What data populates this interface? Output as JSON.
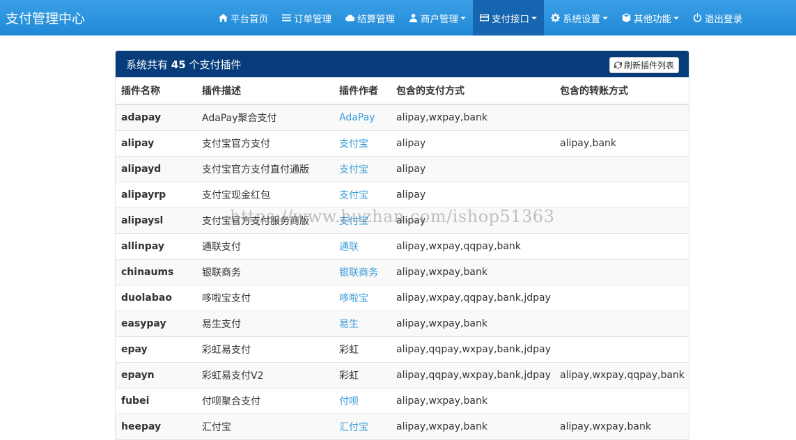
{
  "brand": "支付管理中心",
  "nav": [
    {
      "label": "平台首页",
      "icon": "home-icon",
      "caret": false,
      "active": false
    },
    {
      "label": "订单管理",
      "icon": "list-icon",
      "caret": false,
      "active": false
    },
    {
      "label": "结算管理",
      "icon": "cloud-icon",
      "caret": false,
      "active": false
    },
    {
      "label": "商户管理",
      "icon": "user-icon",
      "caret": true,
      "active": false
    },
    {
      "label": "支付接口",
      "icon": "credit-card-icon",
      "caret": true,
      "active": true
    },
    {
      "label": "系统设置",
      "icon": "gear-icon",
      "caret": true,
      "active": false
    },
    {
      "label": "其他功能",
      "icon": "cube-icon",
      "caret": true,
      "active": false
    },
    {
      "label": "退出登录",
      "icon": "power-icon",
      "caret": false,
      "active": false
    }
  ],
  "panel": {
    "title_prefix": "系统共有",
    "count": "45",
    "title_suffix": "个支付插件",
    "refresh_label": "刷新插件列表"
  },
  "table": {
    "headers": [
      "插件名称",
      "插件描述",
      "插件作者",
      "包含的支付方式",
      "包含的转账方式"
    ],
    "rows": [
      {
        "name": "adapay",
        "desc": "AdaPay聚合支付",
        "author": "AdaPay",
        "author_link": true,
        "pay": "alipay,wxpay,bank",
        "transfer": ""
      },
      {
        "name": "alipay",
        "desc": "支付宝官方支付",
        "author": "支付宝",
        "author_link": true,
        "pay": "alipay",
        "transfer": "alipay,bank"
      },
      {
        "name": "alipayd",
        "desc": "支付宝官方支付直付通版",
        "author": "支付宝",
        "author_link": true,
        "pay": "alipay",
        "transfer": ""
      },
      {
        "name": "alipayrp",
        "desc": "支付宝现金红包",
        "author": "支付宝",
        "author_link": true,
        "pay": "alipay",
        "transfer": ""
      },
      {
        "name": "alipaysl",
        "desc": "支付宝官方支付服务商版",
        "author": "支付宝",
        "author_link": true,
        "pay": "alipay",
        "transfer": ""
      },
      {
        "name": "allinpay",
        "desc": "通联支付",
        "author": "通联",
        "author_link": true,
        "pay": "alipay,wxpay,qqpay,bank",
        "transfer": ""
      },
      {
        "name": "chinaums",
        "desc": "银联商务",
        "author": "银联商务",
        "author_link": true,
        "pay": "alipay,wxpay,bank",
        "transfer": ""
      },
      {
        "name": "duolabao",
        "desc": "哆啦宝支付",
        "author": "哆啦宝",
        "author_link": true,
        "pay": "alipay,wxpay,qqpay,bank,jdpay",
        "transfer": ""
      },
      {
        "name": "easypay",
        "desc": "易生支付",
        "author": "易生",
        "author_link": true,
        "pay": "alipay,wxpay,bank",
        "transfer": ""
      },
      {
        "name": "epay",
        "desc": "彩虹易支付",
        "author": "彩虹",
        "author_link": false,
        "pay": "alipay,qqpay,wxpay,bank,jdpay",
        "transfer": ""
      },
      {
        "name": "epayn",
        "desc": "彩虹易支付V2",
        "author": "彩虹",
        "author_link": false,
        "pay": "alipay,qqpay,wxpay,bank,jdpay",
        "transfer": "alipay,wxpay,qqpay,bank"
      },
      {
        "name": "fubei",
        "desc": "付呗聚合支付",
        "author": "付呗",
        "author_link": true,
        "pay": "alipay,wxpay,bank",
        "transfer": ""
      },
      {
        "name": "heepay",
        "desc": "汇付宝",
        "author": "汇付宝",
        "author_link": true,
        "pay": "alipay,wxpay,bank",
        "transfer": "alipay,wxpay,bank"
      }
    ]
  },
  "watermark": "https://www.huzhan.com/ishop51363",
  "colors": {
    "navbar": "#2a93dd",
    "nav_active": "#1565b0",
    "panel_heading": "#063c79",
    "link": "#3a9bd9"
  }
}
